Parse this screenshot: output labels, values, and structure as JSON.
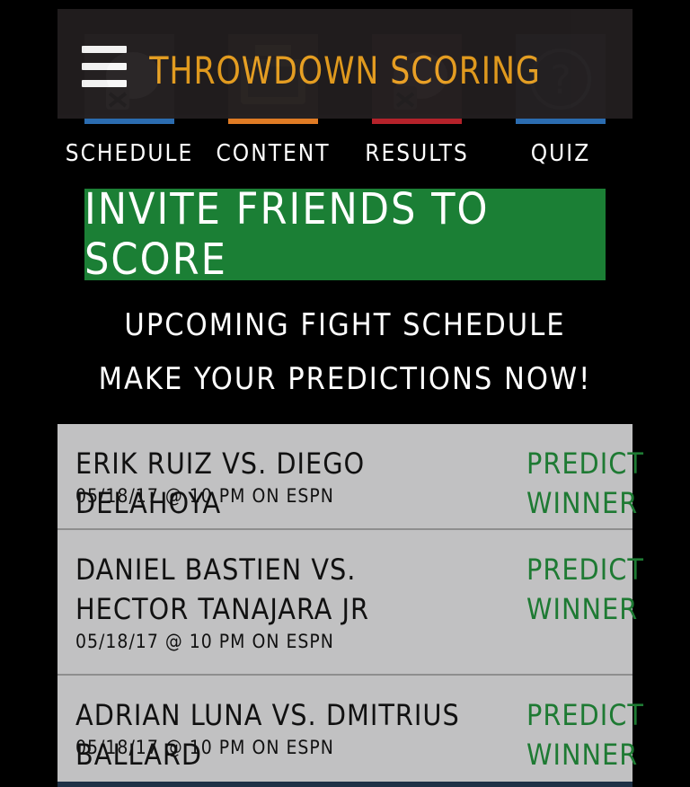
{
  "header": {
    "title": "THROWDOWN SCORING",
    "menu_icon": "hamburger-menu-icon"
  },
  "nav": {
    "tiles": [
      {
        "label": "SCHEDULE",
        "icon": "boxing-glove-icon",
        "accent": "#2b6cb0"
      },
      {
        "label": "CONTENT",
        "icon": "tv-screen-icon",
        "accent": "#e07b24"
      },
      {
        "label": "RESULTS",
        "icon": "boxing-glove-icon",
        "accent": "#b5222a"
      },
      {
        "label": "QUIZ",
        "icon": "question-mark-icon",
        "accent": "#2b6cb0"
      }
    ]
  },
  "invite": {
    "label": "INVITE FRIENDS TO SCORE",
    "color": "#1b7f35"
  },
  "schedule": {
    "heading": "UPCOMING FIGHT SCHEDULE",
    "subheading": "MAKE YOUR PREDICTIONS NOW!"
  },
  "fights": [
    {
      "name": "ERIK RUIZ VS. DIEGO DELAHOYA",
      "date": "05/18/17 @ 10 PM ON ESPN",
      "action_line1": "PREDICT",
      "action_line2": "WINNER"
    },
    {
      "name": "DANIEL BASTIEN VS. HECTOR TANAJARA JR",
      "date": "05/18/17 @ 10 PM ON ESPN",
      "action_line1": "PREDICT",
      "action_line2": "WINNER"
    },
    {
      "name": "ADRIAN LUNA VS. DMITRIUS BALLARD",
      "date": "05/18/17 @ 10 PM ON ESPN",
      "action_line1": "PREDICT",
      "action_line2": "WINNER"
    }
  ],
  "colors": {
    "title": "#f0a521",
    "predict": "#1e7a33",
    "row_bg": "#c1c1c2"
  }
}
